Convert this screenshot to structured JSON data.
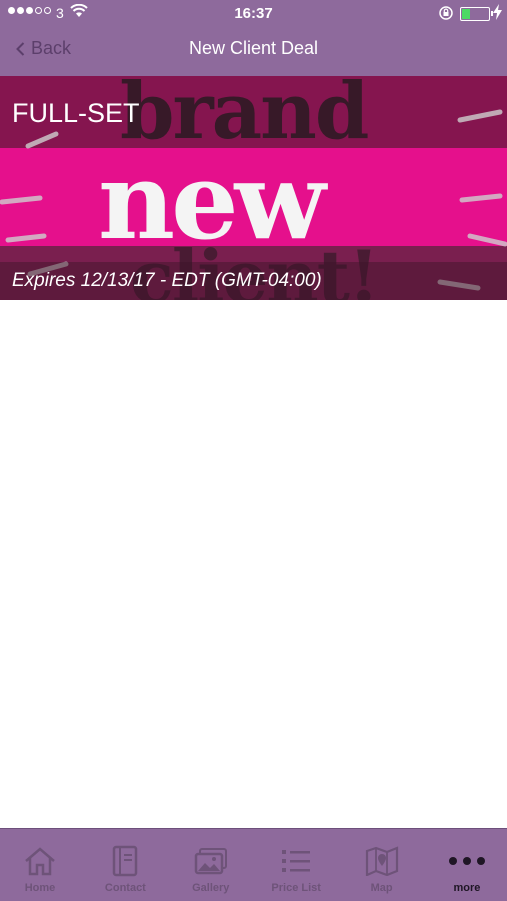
{
  "status_bar": {
    "carrier": "3",
    "time": "16:37",
    "battery_color": "#4cd964"
  },
  "nav": {
    "back_label": "Back",
    "title": "New Client Deal"
  },
  "deal": {
    "title": "FULL-SET",
    "expiry": "Expires 12/13/17 - EDT (GMT-04:00)",
    "banner_words": [
      "brand",
      "new",
      "client!"
    ],
    "colors": {
      "pink": "#e5108c",
      "maroon": "#85154f"
    }
  },
  "tabs": [
    {
      "label": "Home",
      "icon": "home-icon"
    },
    {
      "label": "Contact",
      "icon": "contact-book-icon"
    },
    {
      "label": "Gallery",
      "icon": "gallery-icon"
    },
    {
      "label": "Price List",
      "icon": "list-icon"
    },
    {
      "label": "Map",
      "icon": "map-icon"
    },
    {
      "label": "more",
      "icon": "more-dots-icon",
      "active": true
    }
  ],
  "theme": {
    "bar_color": "#8e6a9c"
  }
}
